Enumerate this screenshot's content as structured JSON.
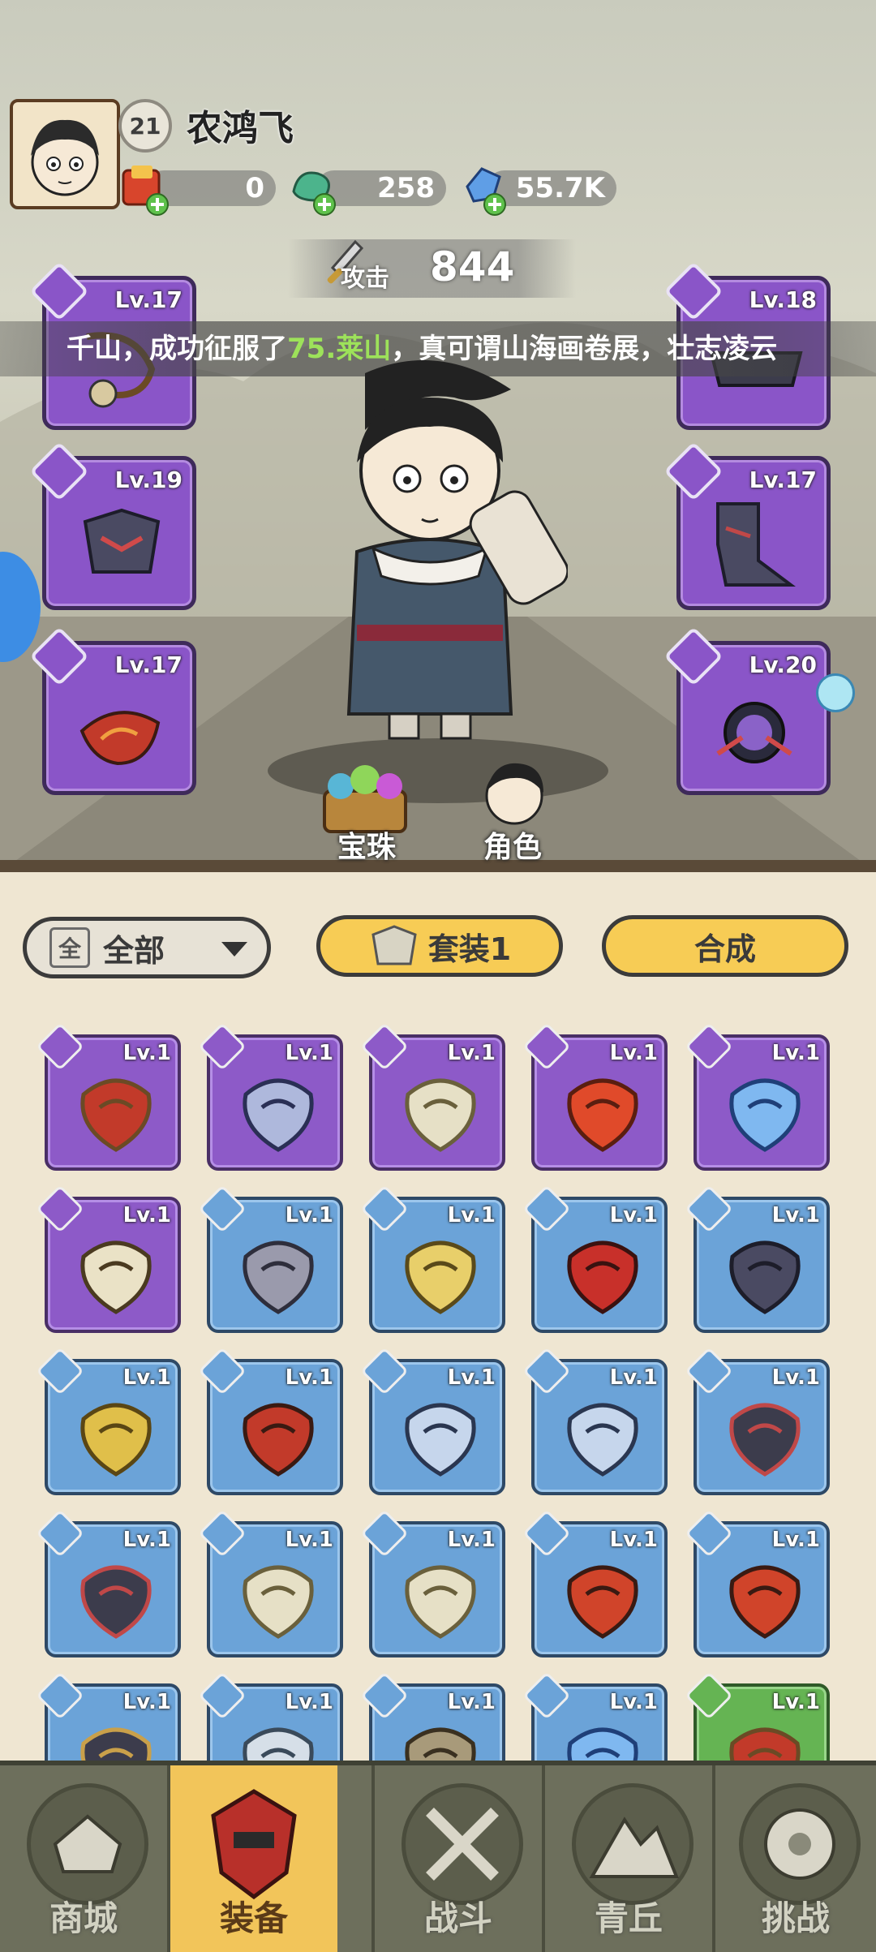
{
  "player": {
    "level": "21",
    "name": "农鸿飞",
    "currencies": [
      {
        "icon": "red-envelope-icon",
        "value": "0"
      },
      {
        "icon": "jade-dragon-icon",
        "value": "258"
      },
      {
        "icon": "blue-crystal-icon",
        "value": "55.7K"
      }
    ]
  },
  "attack": {
    "label": "攻击",
    "value": "844"
  },
  "marquee": {
    "before": "千山，成功征服了",
    "highlight": "75.莱山",
    "after": "，真可谓山海画卷展，壮志凌云"
  },
  "equipped": [
    {
      "slot": "left-1",
      "level": "Lv.17"
    },
    {
      "slot": "left-2",
      "level": "Lv.19"
    },
    {
      "slot": "left-3",
      "level": "Lv.17"
    },
    {
      "slot": "right-1",
      "level": "Lv.18"
    },
    {
      "slot": "right-2",
      "level": "Lv.17"
    },
    {
      "slot": "right-3",
      "level": "Lv.20"
    }
  ],
  "scene_buttons": {
    "gems": "宝珠",
    "character": "角色"
  },
  "filters": {
    "all_box": "全",
    "all": "全部",
    "set": "套装1",
    "merge": "合成"
  },
  "inventory": [
    {
      "rarity": "purple",
      "icon": "weapon-whip-icon",
      "level": "Lv.1"
    },
    {
      "rarity": "purple",
      "icon": "crossbow-icon",
      "level": "Lv.1"
    },
    {
      "rarity": "purple",
      "icon": "wing-bracer-icon",
      "level": "Lv.1"
    },
    {
      "rarity": "purple",
      "icon": "fire-orb-icon",
      "level": "Lv.1"
    },
    {
      "rarity": "purple",
      "icon": "jade-pendant-icon",
      "level": "Lv.1"
    },
    {
      "rarity": "purple",
      "icon": "claw-necklace-icon",
      "level": "Lv.1"
    },
    {
      "rarity": "blue",
      "icon": "hammer-icon",
      "level": "Lv.1"
    },
    {
      "rarity": "blue",
      "icon": "scepter-icon",
      "level": "Lv.1"
    },
    {
      "rarity": "blue",
      "icon": "red-helmet-icon",
      "level": "Lv.1"
    },
    {
      "rarity": "blue",
      "icon": "dark-helmet-icon",
      "level": "Lv.1"
    },
    {
      "rarity": "blue",
      "icon": "gold-armor-icon",
      "level": "Lv.1"
    },
    {
      "rarity": "blue",
      "icon": "red-bracer-icon",
      "level": "Lv.1"
    },
    {
      "rarity": "blue",
      "icon": "ice-bracer-icon",
      "level": "Lv.1"
    },
    {
      "rarity": "blue",
      "icon": "ice-bracer-icon",
      "level": "Lv.1"
    },
    {
      "rarity": "blue",
      "icon": "dark-bracer-icon",
      "level": "Lv.1"
    },
    {
      "rarity": "blue",
      "icon": "dark-bracer-icon",
      "level": "Lv.1"
    },
    {
      "rarity": "blue",
      "icon": "wing-bracer-icon",
      "level": "Lv.1"
    },
    {
      "rarity": "blue",
      "icon": "wing-bracer-icon",
      "level": "Lv.1"
    },
    {
      "rarity": "blue",
      "icon": "lotus-belt-icon",
      "level": "Lv.1"
    },
    {
      "rarity": "blue",
      "icon": "lotus-belt-icon",
      "level": "Lv.1"
    },
    {
      "rarity": "blue",
      "icon": "belt-icon",
      "level": "Lv.1"
    },
    {
      "rarity": "blue",
      "icon": "boots-icon",
      "level": "Lv.1"
    },
    {
      "rarity": "blue",
      "icon": "bracer-icon",
      "level": "Lv.1"
    },
    {
      "rarity": "blue",
      "icon": "jade-pendant-icon",
      "level": "Lv.1"
    },
    {
      "rarity": "green",
      "icon": "weapon-whip-icon",
      "level": "Lv.1"
    }
  ],
  "nav": [
    {
      "label": "商城",
      "icon": "shop-icon"
    },
    {
      "label": "装备",
      "icon": "equipment-icon",
      "active": true
    },
    {
      "label": "战斗",
      "icon": "battle-icon"
    },
    {
      "label": "青丘",
      "icon": "mountain-icon"
    },
    {
      "label": "挑战",
      "icon": "challenge-icon"
    }
  ],
  "colors": {
    "rare": "#8d5ac8",
    "common": "#6ba3d8",
    "uncommon": "#65b453",
    "accent": "#f7cc55"
  }
}
